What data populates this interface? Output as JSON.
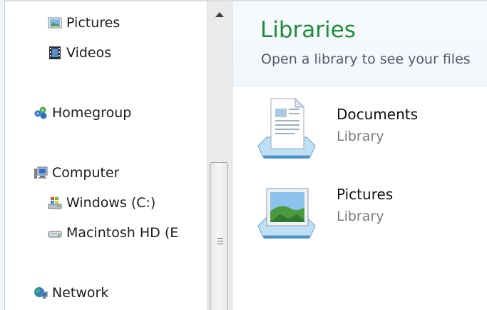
{
  "nav": {
    "items": [
      {
        "label": "Pictures",
        "icon": "pictures-icon"
      },
      {
        "label": "Videos",
        "icon": "videos-icon"
      },
      {
        "label": "Homegroup",
        "icon": "homegroup-icon"
      },
      {
        "label": "Computer",
        "icon": "computer-icon"
      },
      {
        "label": "Windows (C:)",
        "icon": "windows-drive-icon"
      },
      {
        "label": "Macintosh HD (E",
        "icon": "hard-drive-icon"
      },
      {
        "label": "Network",
        "icon": "network-icon"
      }
    ]
  },
  "content": {
    "title": "Libraries",
    "subtitle": "Open a library to see your files",
    "libraries": [
      {
        "name": "Documents",
        "type": "Library",
        "icon": "documents-library-icon"
      },
      {
        "name": "Pictures",
        "type": "Library",
        "icon": "pictures-library-icon"
      }
    ]
  },
  "colors": {
    "title_green": "#1e8f3a",
    "subtitle_gray": "#515b66",
    "library_type_gray": "#7a7a7a"
  }
}
